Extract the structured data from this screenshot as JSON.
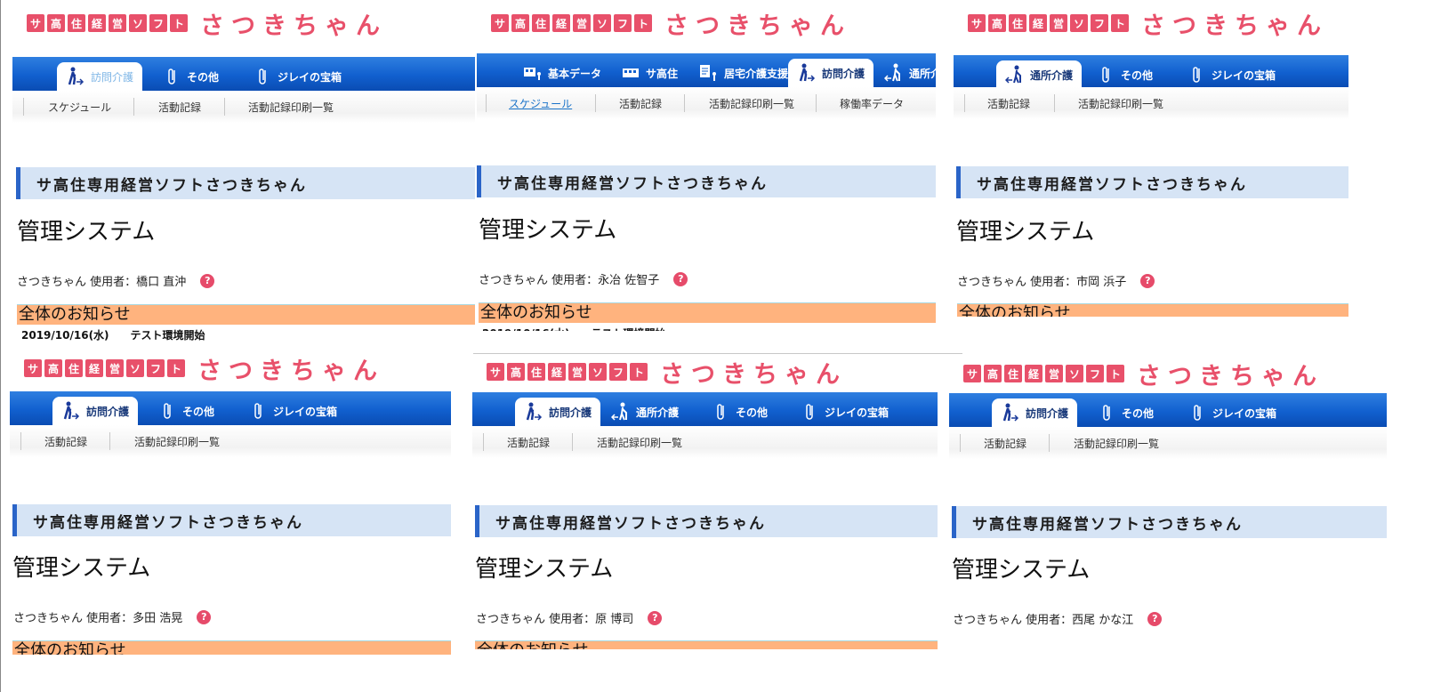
{
  "logo": {
    "chars": [
      "サ",
      "高",
      "住",
      "経",
      "営",
      "ソ",
      "フ",
      "ト"
    ],
    "name": "さつきちゃん"
  },
  "common": {
    "banner": "サ高住専用経営ソフトさつきちゃん",
    "title": "管理システム",
    "user_prefix": "さつきちゃん 使用者：",
    "help_glyph": "?",
    "notice": "全体のお知らせ",
    "notice_line": "2019/10/16(水)　　テスト環境開始"
  },
  "panels": [
    {
      "tabs": [
        "訪問介護",
        "その他",
        "ジレイの宝箱"
      ],
      "subnav": [
        "スケジュール",
        "活動記録",
        "活動記録印刷一覧"
      ],
      "user": "橋口 直沖"
    },
    {
      "tabs": [
        "基本データ",
        "サ高住",
        "居宅介護支援",
        "訪問介護",
        "通所介"
      ],
      "subnav": [
        "スケジュール",
        "活動記録",
        "活動記録印刷一覧",
        "稼働率データ"
      ],
      "user": "永冶 佐智子"
    },
    {
      "tabs": [
        "通所介護",
        "その他",
        "ジレイの宝箱"
      ],
      "subnav": [
        "活動記録",
        "活動記録印刷一覧"
      ],
      "user": "市岡 浜子"
    },
    {
      "tabs": [
        "訪問介護",
        "その他",
        "ジレイの宝箱"
      ],
      "subnav": [
        "活動記録",
        "活動記録印刷一覧"
      ],
      "user": "多田 浩晃"
    },
    {
      "tabs": [
        "訪問介護",
        "通所介護",
        "その他",
        "ジレイの宝箱"
      ],
      "subnav": [
        "活動記録",
        "活動記録印刷一覧"
      ],
      "user": "原 博司"
    },
    {
      "tabs": [
        "訪問介護",
        "その他",
        "ジレイの宝箱"
      ],
      "subnav": [
        "活動記録",
        "活動記録印刷一覧"
      ],
      "user": "西尾 かな江"
    }
  ],
  "colors": {
    "brand_pink": "#e8506a",
    "tab_blue": "#1160cf",
    "banner_bg": "#d6e4f5",
    "notice_bg": "#ffb37e"
  },
  "icons": {
    "caregiver": "walking-person-icon",
    "clip": "paperclip-icon",
    "help": "help-icon"
  }
}
